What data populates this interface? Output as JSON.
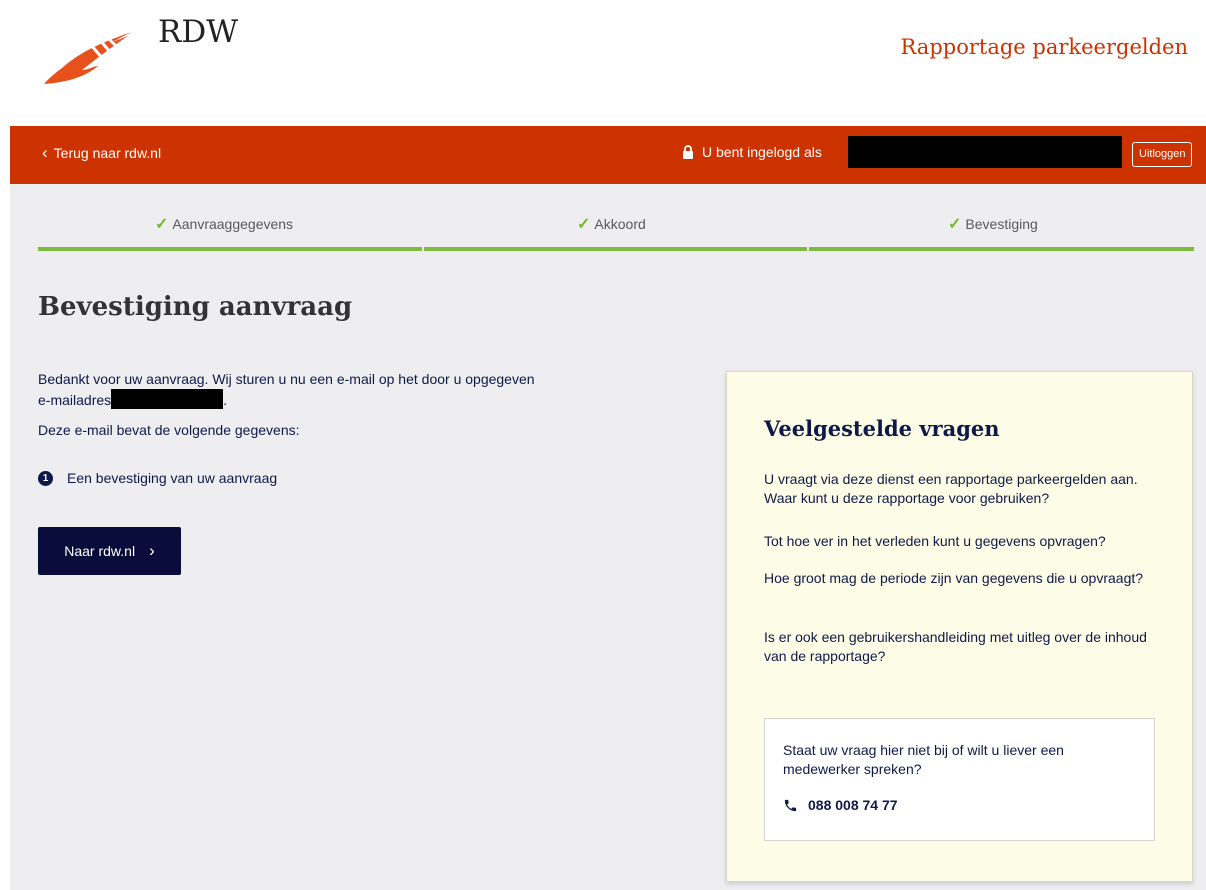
{
  "header": {
    "logo_text": "RDW",
    "site_title": "Rapportage parkeergelden"
  },
  "topbar": {
    "back_label": "Terug naar rdw.nl",
    "login_label": "U bent ingelogd als",
    "logout_label": "Uitloggen"
  },
  "steps": [
    {
      "label": "Aanvraaggegevens"
    },
    {
      "label": "Akkoord"
    },
    {
      "label": "Bevestiging"
    }
  ],
  "main": {
    "title": "Bevestiging aanvraag",
    "intro_part1": "Bedankt voor uw aanvraag. Wij sturen u nu een e-mail op het door u opgegeven",
    "intro_part2": "e-mailadres",
    "intro_end": ".",
    "contents_label": "Deze e-mail bevat de volgende gegevens:",
    "items": [
      {
        "number": "1",
        "text": "Een bevestiging van uw aanvraag"
      }
    ],
    "button_label": "Naar rdw.nl"
  },
  "faq": {
    "title": "Veelgestelde vragen",
    "questions": [
      "U vraagt via deze dienst een rapportage parkeergelden aan. Waar kunt u deze rapportage voor gebruiken?",
      "Tot hoe ver in het verleden kunt u gegevens opvragen?",
      "Hoe groot mag de periode zijn van gegevens die u opvraagt?",
      "Is er ook een gebruikershandleiding met uitleg over de inhoud van de rapportage?"
    ],
    "contact_text": "Staat uw vraag hier niet bij of wilt u liever een medewerker spreken?",
    "phone": "088 008 74 77"
  },
  "colors": {
    "brand_red": "#cc3300",
    "navy": "#0f1947",
    "step_green": "#7dbb42",
    "faq_bg": "#fdfde7"
  }
}
